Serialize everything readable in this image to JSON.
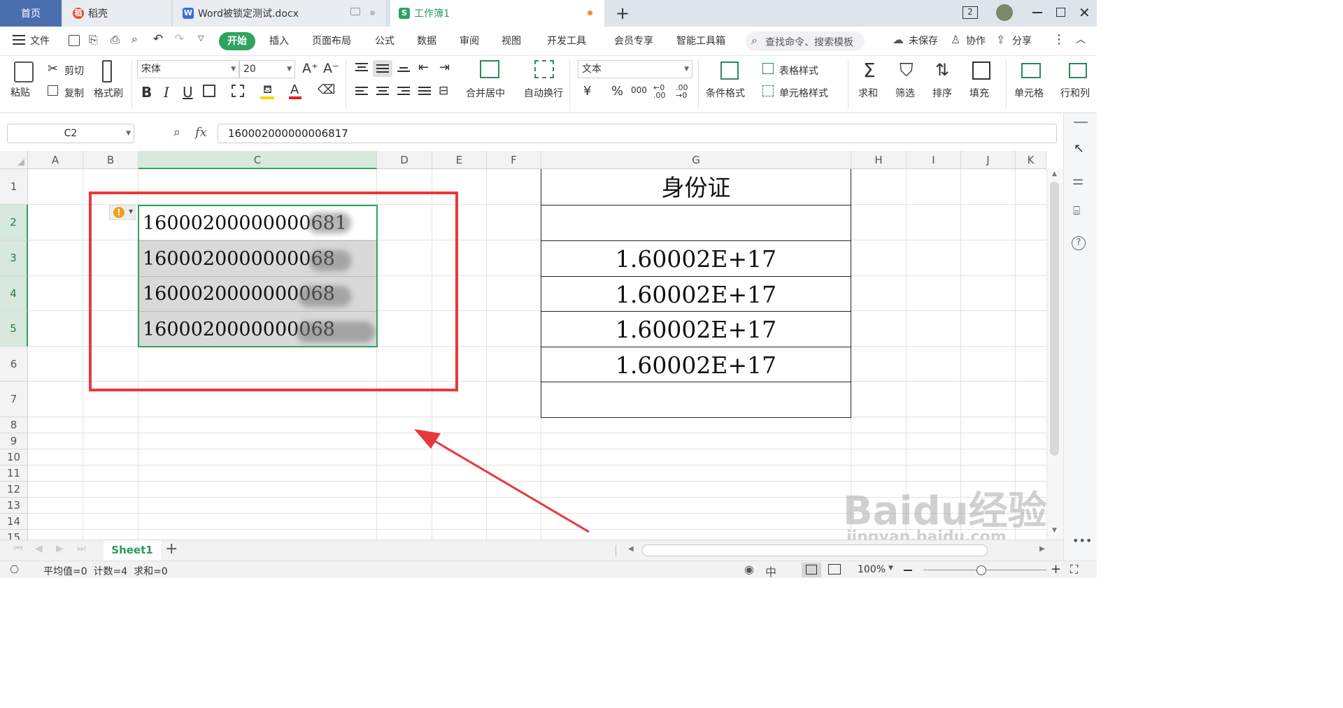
{
  "tabs": {
    "home": "首页",
    "docer": "稻壳",
    "word_doc": "Word被锁定测试.docx",
    "workbook": "工作簿1",
    "add": "+"
  },
  "menu": {
    "file": "文件",
    "start": "开始",
    "insert": "插入",
    "layout": "页面布局",
    "formula": "公式",
    "data": "数据",
    "review": "审阅",
    "view": "视图",
    "devtools": "开发工具",
    "member": "会员专享",
    "smart": "智能工具箱",
    "search_placeholder": "查找命令、搜索模板",
    "unsaved": "未保存",
    "collab": "协作",
    "share": "分享"
  },
  "ribbon": {
    "paste": "粘贴",
    "cut": "剪切",
    "copy": "复制",
    "format_painter": "格式刷",
    "font_name": "宋体",
    "font_size": "20",
    "merge_center": "合并居中",
    "wrap": "自动换行",
    "number_format": "文本",
    "cond_format": "条件格式",
    "table_style": "表格样式",
    "cell_style": "单元格样式",
    "sum": "求和",
    "filter": "筛选",
    "sort": "排序",
    "fill": "填充",
    "cell": "单元格",
    "row_col": "行和列"
  },
  "formula_bar": {
    "name_box": "C2",
    "fx": "fx",
    "value": "160002000000006817"
  },
  "columns": [
    "A",
    "B",
    "C",
    "D",
    "E",
    "F",
    "G",
    "H",
    "I",
    "J",
    "K"
  ],
  "rows": [
    "1",
    "2",
    "3",
    "4",
    "5",
    "6",
    "7",
    "8",
    "9",
    "10",
    "11",
    "12",
    "13",
    "14",
    "15"
  ],
  "cells": {
    "C2": "16000200000000681",
    "C3": "1600020000000068",
    "C4": "1600020000000068",
    "C5": "1600020000000068",
    "G1": "身份证",
    "G3": "1.60002E+17",
    "G4": "1.60002E+17",
    "G5": "1.60002E+17",
    "G6": "1.60002E+17"
  },
  "sheet_tab": "Sheet1",
  "status": {
    "summary": "平均值=0  计数=4  求和=0",
    "zoom": "100%"
  },
  "watermark": {
    "brand": "Baidu经验",
    "url": "jingyan.baidu.com"
  },
  "colors": {
    "accent_green": "#2fa460",
    "annotation_red": "#e8383d",
    "tab_blue": "#4a6fb0"
  }
}
